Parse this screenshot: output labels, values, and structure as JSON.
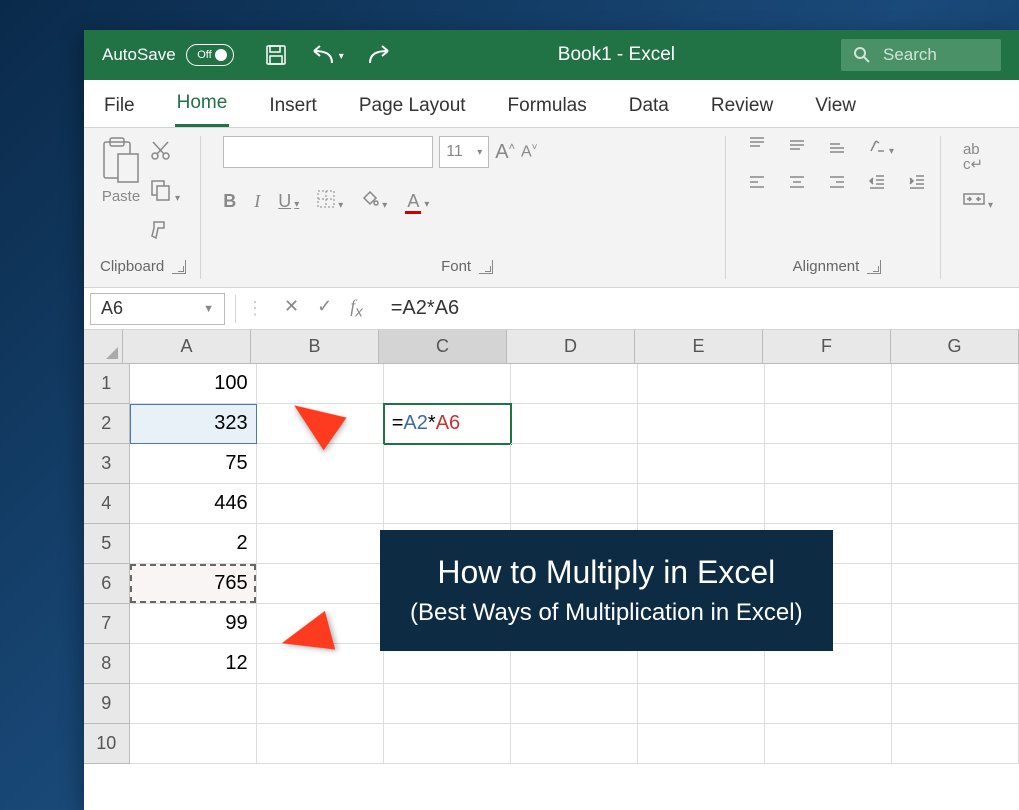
{
  "titlebar": {
    "autosave_label": "AutoSave",
    "toggle_state": "Off",
    "doc_name": "Book1",
    "app_name": "Excel",
    "separator": " - ",
    "search_placeholder": "Search"
  },
  "tabs": [
    "File",
    "Home",
    "Insert",
    "Page Layout",
    "Formulas",
    "Data",
    "Review",
    "View"
  ],
  "active_tab": "Home",
  "ribbon": {
    "clipboard": {
      "label": "Clipboard",
      "paste": "Paste"
    },
    "font": {
      "label": "Font",
      "size": "11",
      "bold": "B",
      "italic": "I",
      "underline": "U"
    },
    "alignment": {
      "label": "Alignment",
      "wrap": "ab",
      "wrap2": "c↵"
    }
  },
  "formula_bar": {
    "name_box": "A6",
    "formula": "=A2*A6"
  },
  "columns": [
    "A",
    "B",
    "C",
    "D",
    "E",
    "F",
    "G"
  ],
  "active_col": "C",
  "grid": {
    "rows": [
      {
        "n": "1",
        "A": "100"
      },
      {
        "n": "2",
        "A": "323",
        "C_formula": {
          "ref1": "A2",
          "op": "*",
          "ref2": "A6"
        }
      },
      {
        "n": "3",
        "A": "75"
      },
      {
        "n": "4",
        "A": "446"
      },
      {
        "n": "5",
        "A": "2"
      },
      {
        "n": "6",
        "A": "765"
      },
      {
        "n": "7",
        "A": "99"
      },
      {
        "n": "8",
        "A": "12"
      },
      {
        "n": "9",
        "A": ""
      },
      {
        "n": "10",
        "A": ""
      }
    ]
  },
  "overlay": {
    "title": "How to Multiply in Excel",
    "sub": "(Best Ways of Multiplication in Excel)"
  }
}
